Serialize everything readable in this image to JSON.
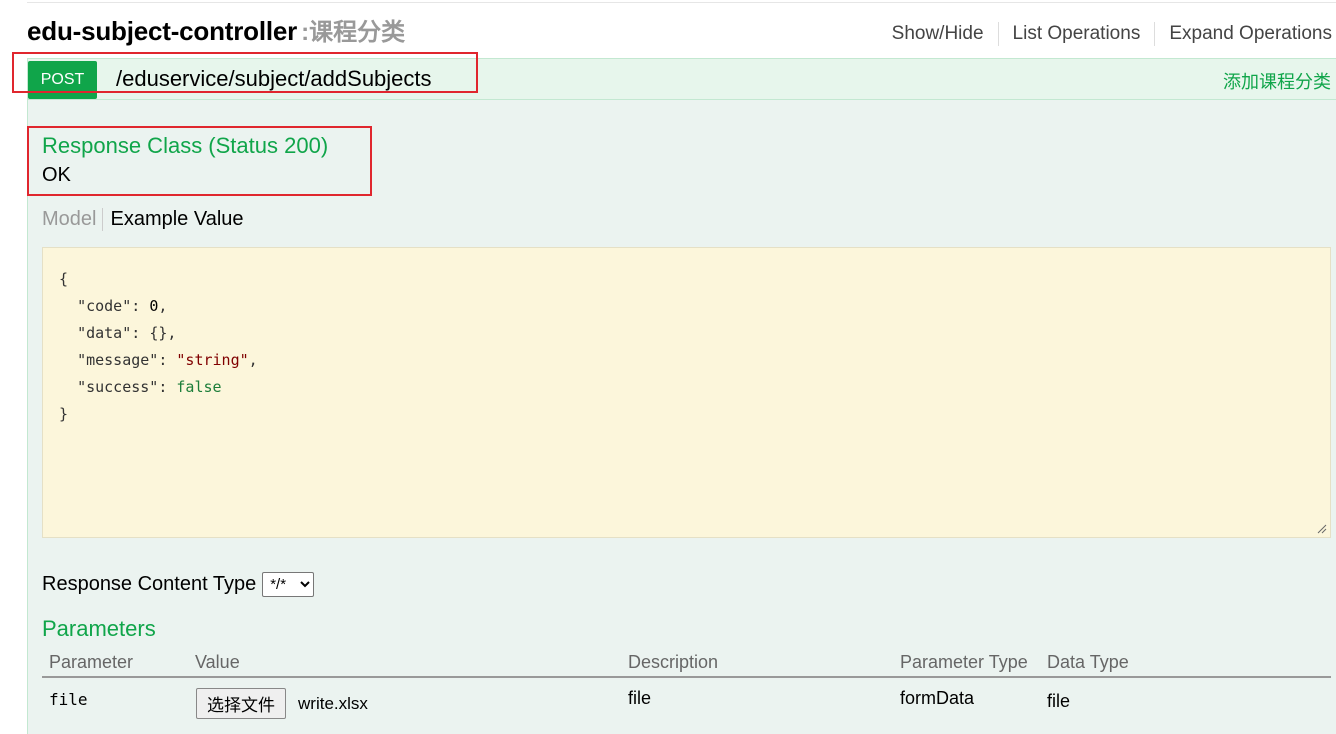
{
  "header": {
    "controller": "edu-subject-controller",
    "separator": ":",
    "description": "课程分类",
    "links": [
      "Show/Hide",
      "List Operations",
      "Expand Operations"
    ]
  },
  "operation": {
    "method": "POST",
    "path": "/eduservice/subject/addSubjects",
    "summary": "添加课程分类"
  },
  "response": {
    "title": "Response Class (Status 200)",
    "status_text": "OK",
    "tabs": {
      "model": "Model",
      "example": "Example Value"
    },
    "example": {
      "open": "{",
      "close": "}",
      "k_code": "\"code\"",
      "v_code": "0",
      "k_data": "\"data\"",
      "v_data": "{}",
      "k_message": "\"message\"",
      "v_message": "\"string\"",
      "k_success": "\"success\"",
      "v_success": "false"
    },
    "content_type_label": "Response Content Type",
    "content_type_value": "*/*"
  },
  "parameters": {
    "title": "Parameters",
    "headers": [
      "Parameter",
      "Value",
      "Description",
      "Parameter Type",
      "Data Type"
    ],
    "rows": [
      {
        "name": "file",
        "button_label": "选择文件",
        "file_name": "write.xlsx",
        "description": "file",
        "param_type": "formData",
        "data_type": "file"
      }
    ]
  },
  "colors": {
    "accent_green": "#10a54a",
    "highlight_red": "#e0262e",
    "code_bg": "#fcf6db"
  }
}
